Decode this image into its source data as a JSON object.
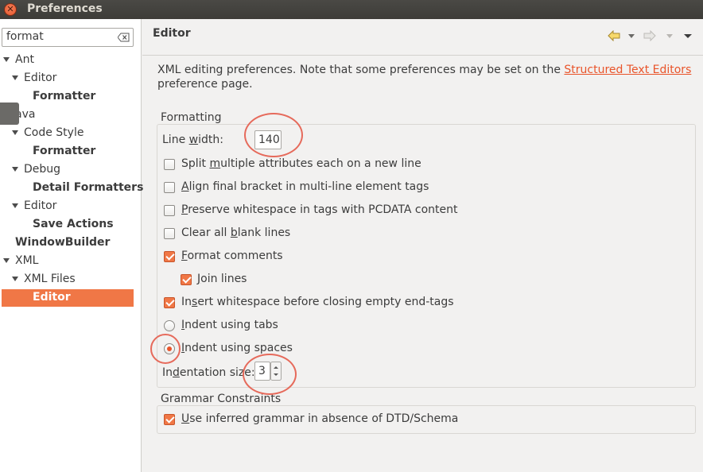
{
  "window": {
    "title": "Preferences"
  },
  "filter": {
    "value": "format"
  },
  "tree": [
    {
      "label": "Ant",
      "depth": 0,
      "expanded": true,
      "bold": false
    },
    {
      "label": "Editor",
      "depth": 1,
      "expanded": true,
      "bold": false
    },
    {
      "label": "Formatter",
      "depth": 2,
      "expanded": false,
      "bold": true
    },
    {
      "label": "ava",
      "depth": 0,
      "expanded": true,
      "bold": false
    },
    {
      "label": "Code Style",
      "depth": 1,
      "expanded": true,
      "bold": false
    },
    {
      "label": "Formatter",
      "depth": 2,
      "expanded": false,
      "bold": true
    },
    {
      "label": "Debug",
      "depth": 1,
      "expanded": true,
      "bold": false
    },
    {
      "label": "Detail Formatters",
      "depth": 2,
      "expanded": false,
      "bold": true
    },
    {
      "label": "Editor",
      "depth": 1,
      "expanded": true,
      "bold": false
    },
    {
      "label": "Save Actions",
      "depth": 2,
      "expanded": false,
      "bold": true
    },
    {
      "label": "WindowBuilder",
      "depth": 0,
      "expanded": false,
      "bold": true
    },
    {
      "label": "XML",
      "depth": 0,
      "expanded": true,
      "bold": false
    },
    {
      "label": "XML Files",
      "depth": 1,
      "expanded": true,
      "bold": false
    },
    {
      "label": "Editor",
      "depth": 2,
      "expanded": false,
      "bold": true,
      "selected": true
    }
  ],
  "page": {
    "title": "Editor",
    "desc_before": "XML editing preferences.  Note that some preferences may be set on the ",
    "desc_link": "Structured Text Editors",
    "desc_after": "preference page."
  },
  "formatting": {
    "group_title": "Formatting",
    "line_width_label": "Line width:",
    "line_width_value": "140",
    "split_attrs": {
      "label": "Split multiple attributes each on a new line",
      "checked": false
    },
    "align_bracket": {
      "label": "Align final bracket in multi-line element tags",
      "checked": false
    },
    "preserve_ws": {
      "label": "Preserve whitespace in tags with PCDATA content",
      "checked": false
    },
    "clear_blank": {
      "label": "Clear all blank lines",
      "checked": false
    },
    "format_comments": {
      "label": "Format comments",
      "checked": true
    },
    "join_lines": {
      "label": "Join lines",
      "checked": true
    },
    "insert_ws": {
      "label": "Insert whitespace before closing empty end-tags",
      "checked": true
    },
    "indent_tabs": {
      "label": "Indent using tabs",
      "selected": false
    },
    "indent_spaces": {
      "label": "Indent using spaces",
      "selected": true
    },
    "indent_size_label": "Indentation size:",
    "indent_size_value": "3"
  },
  "grammar": {
    "group_title": "Grammar Constraints",
    "inferred": {
      "label": "Use inferred grammar in absence of DTD/Schema",
      "checked": true
    }
  },
  "colors": {
    "accent": "#f07746",
    "link": "#e9542a",
    "annotation": "#e66a5b"
  }
}
